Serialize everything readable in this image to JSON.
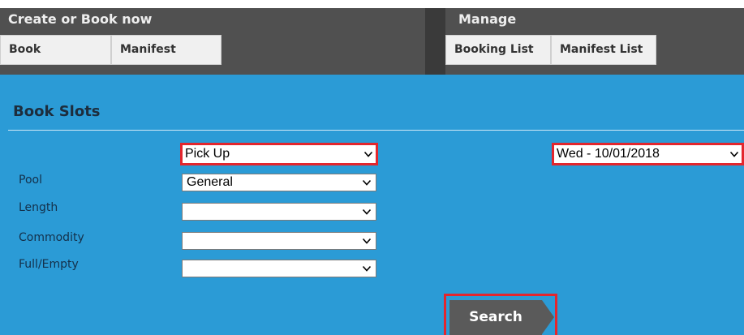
{
  "nav": {
    "create_section": {
      "title": "Create or Book now",
      "tabs": [
        {
          "label": "Book"
        },
        {
          "label": "Manifest"
        }
      ]
    },
    "manage_section": {
      "title": "Manage",
      "tabs": [
        {
          "label": "Booking List"
        },
        {
          "label": "Manifest List"
        }
      ]
    }
  },
  "main": {
    "title": "Book Slots",
    "type_select": {
      "value": "Pick Up"
    },
    "date_select": {
      "value": "Wed - 10/01/2018"
    },
    "fields": [
      {
        "label": "Pool",
        "value": "General"
      },
      {
        "label": "Length",
        "value": ""
      },
      {
        "label": "Commodity",
        "value": ""
      },
      {
        "label": "Full/Empty",
        "value": ""
      }
    ],
    "search_label": "Search"
  },
  "colors": {
    "content_bg": "#2b9bd6",
    "nav_bg": "#505050",
    "highlight": "#e3262d",
    "button_bg": "#5a5a5a"
  }
}
